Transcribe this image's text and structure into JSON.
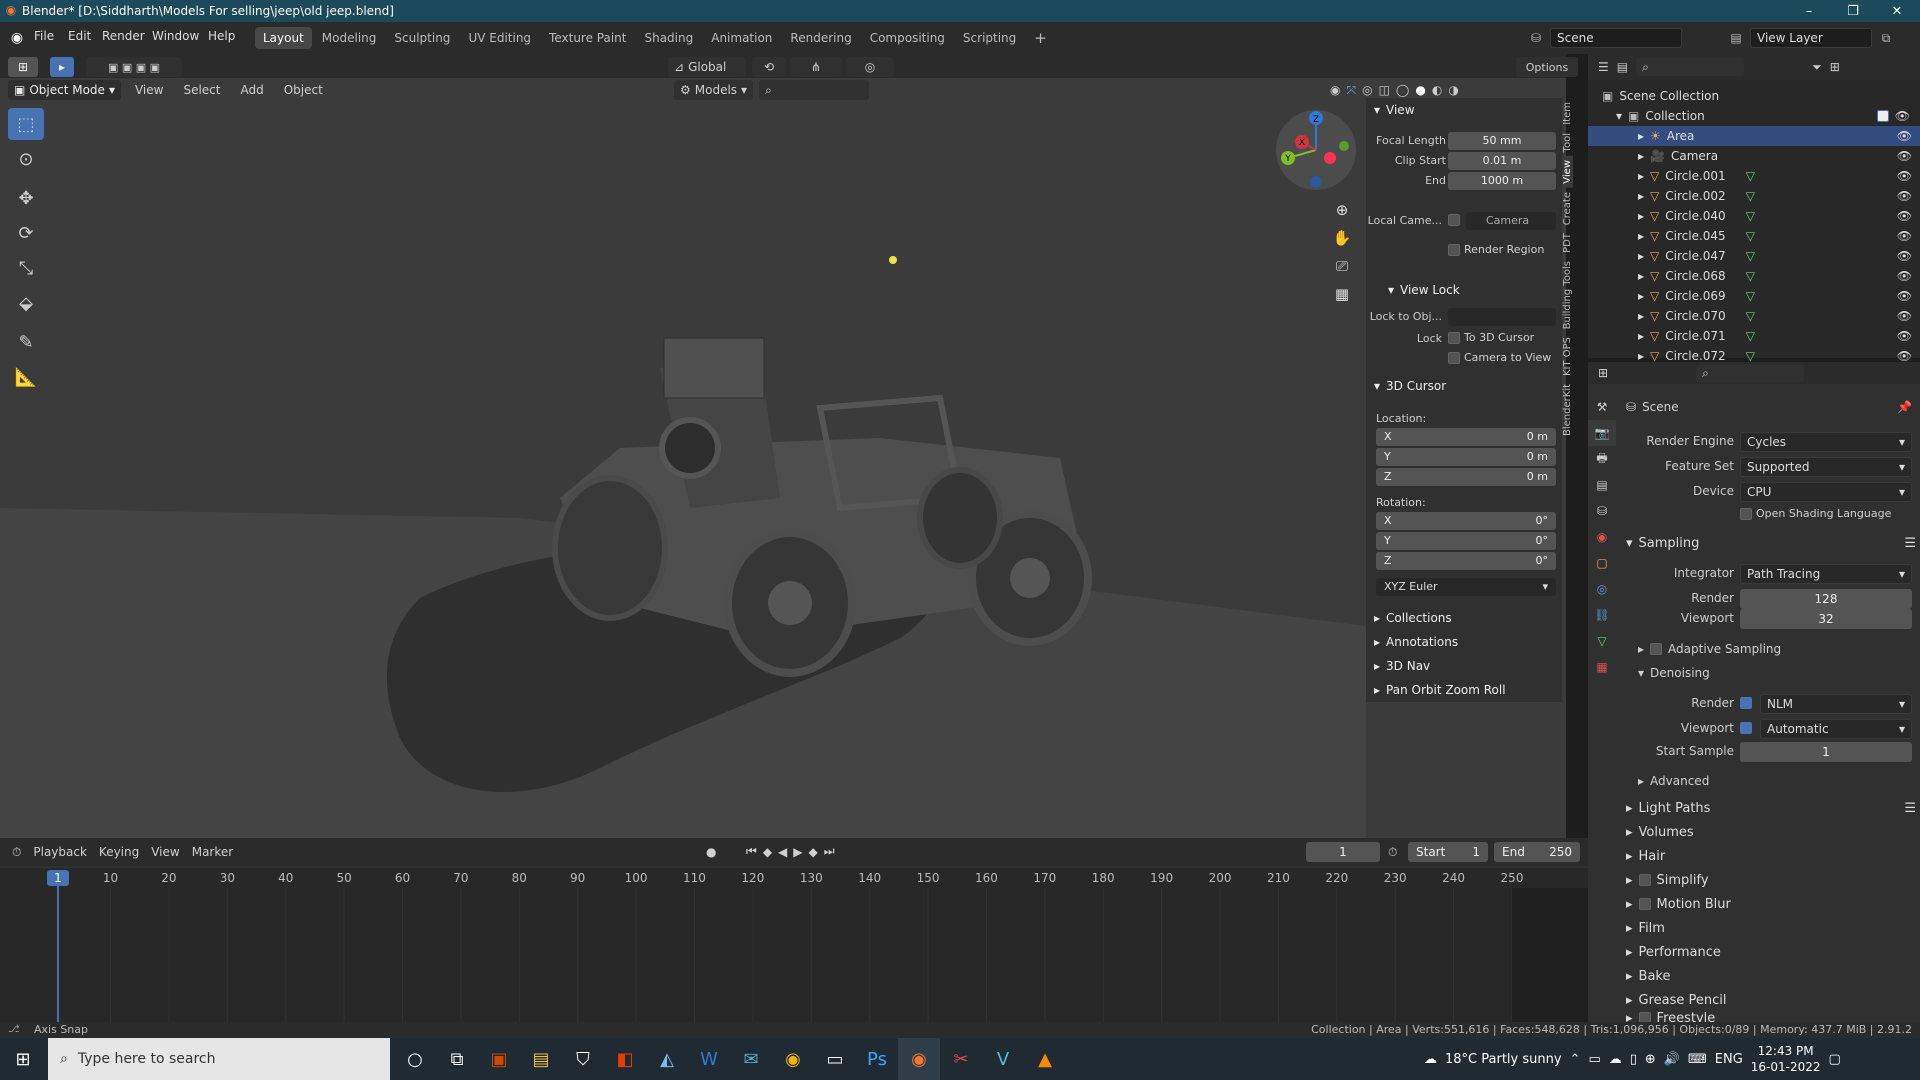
{
  "window": {
    "title": "Blender* [D:\\Siddharth\\Models For selling\\jeep\\old jeep.blend]",
    "min": "–",
    "max": "❐",
    "close": "✕"
  },
  "menu": {
    "file": "File",
    "edit": "Edit",
    "render": "Render",
    "window": "Window",
    "help": "Help"
  },
  "workspaces": [
    "Layout",
    "Modeling",
    "Sculpting",
    "UV Editing",
    "Texture Paint",
    "Shading",
    "Animation",
    "Rendering",
    "Compositing",
    "Scripting",
    "+"
  ],
  "scene": {
    "name": "Scene",
    "view_layer": "View Layer"
  },
  "toolheader": {
    "orientation": "Global",
    "options": "Options"
  },
  "viewport_header": {
    "mode": "Object Mode",
    "view": "View",
    "select": "Select",
    "add": "Add",
    "object": "Object",
    "collection_filter": "Models"
  },
  "npanel": {
    "view_title": "View",
    "focal_length_lbl": "Focal Length",
    "focal_length": "50 mm",
    "clip_start_lbl": "Clip Start",
    "clip_start": "0.01 m",
    "end_lbl": "End",
    "end": "1000 m",
    "local_camera_lbl": "Local Came...",
    "local_camera": "Camera",
    "render_region": "Render Region",
    "view_lock_title": "View Lock",
    "lock_to_obj_lbl": "Lock to Obj...",
    "lock_lbl": "Lock",
    "to_3d_cursor": "To 3D Cursor",
    "camera_to_view": "Camera to View",
    "cursor_title": "3D Cursor",
    "location_lbl": "Location:",
    "loc_x_lbl": "X",
    "loc_x": "0 m",
    "loc_y_lbl": "Y",
    "loc_y": "0 m",
    "loc_z_lbl": "Z",
    "loc_z": "0 m",
    "rotation_lbl": "Rotation:",
    "rot_x_lbl": "X",
    "rot_x": "0°",
    "rot_y_lbl": "Y",
    "rot_y": "0°",
    "rot_z_lbl": "Z",
    "rot_z": "0°",
    "rotation_mode": "XYZ Euler",
    "collections": "Collections",
    "annotations": "Annotations",
    "nav_3d": "3D Nav",
    "pan_orbit": "Pan Orbit Zoom Roll",
    "tabs": [
      "Item",
      "Tool",
      "View",
      "Create",
      "PDT",
      "Building Tools",
      "KIT OPS",
      "BlenderKit"
    ]
  },
  "outliner": {
    "scene_collection": "Scene Collection",
    "collection": "Collection",
    "items": [
      "Area",
      "Camera",
      "Circle.001",
      "Circle.002",
      "Circle.040",
      "Circle.045",
      "Circle.047",
      "Circle.068",
      "Circle.069",
      "Circle.070",
      "Circle.071",
      "Circle.072"
    ]
  },
  "properties": {
    "scene": "Scene",
    "render_engine_lbl": "Render Engine",
    "render_engine": "Cycles",
    "feature_set_lbl": "Feature Set",
    "feature_set": "Supported",
    "device_lbl": "Device",
    "device": "CPU",
    "osl": "Open Shading Language",
    "sampling": "Sampling",
    "integrator_lbl": "Integrator",
    "integrator": "Path Tracing",
    "render_lbl": "Render",
    "render": "128",
    "viewport_lbl": "Viewport",
    "viewport": "32",
    "adaptive": "Adaptive Sampling",
    "denoising": "Denoising",
    "dn_render_lbl": "Render",
    "dn_render": "NLM",
    "dn_viewport_lbl": "Viewport",
    "dn_viewport": "Automatic",
    "start_sample_lbl": "Start Sample",
    "start_sample": "1",
    "advanced": "Advanced",
    "sections": [
      "Light Paths",
      "Volumes",
      "Hair",
      "Simplify",
      "Motion Blur",
      "Film",
      "Performance",
      "Bake",
      "Grease Pencil",
      "Freestyle"
    ]
  },
  "timeline": {
    "playback": "Playback",
    "keying": "Keying",
    "view": "View",
    "marker": "Marker",
    "current_frame": "1",
    "start_lbl": "Start",
    "start": "1",
    "end_lbl": "End",
    "end": "250",
    "ticks": [
      "1",
      "10",
      "20",
      "30",
      "40",
      "50",
      "60",
      "70",
      "80",
      "90",
      "100",
      "110",
      "120",
      "130",
      "140",
      "150",
      "160",
      "170",
      "180",
      "190",
      "200",
      "210",
      "220",
      "230",
      "240",
      "250"
    ]
  },
  "statusbar": {
    "left": "Axis Snap",
    "right": "Collection | Area | Verts:551,616 | Faces:548,628 | Tris:1,096,956 | Objects:0/89 | Memory: 437.7 MiB | 2.91.2"
  },
  "taskbar": {
    "search": "Type here to search",
    "weather": "18°C  Partly sunny",
    "lang": "ENG",
    "time": "12:43 PM",
    "date": "16-01-2022"
  }
}
